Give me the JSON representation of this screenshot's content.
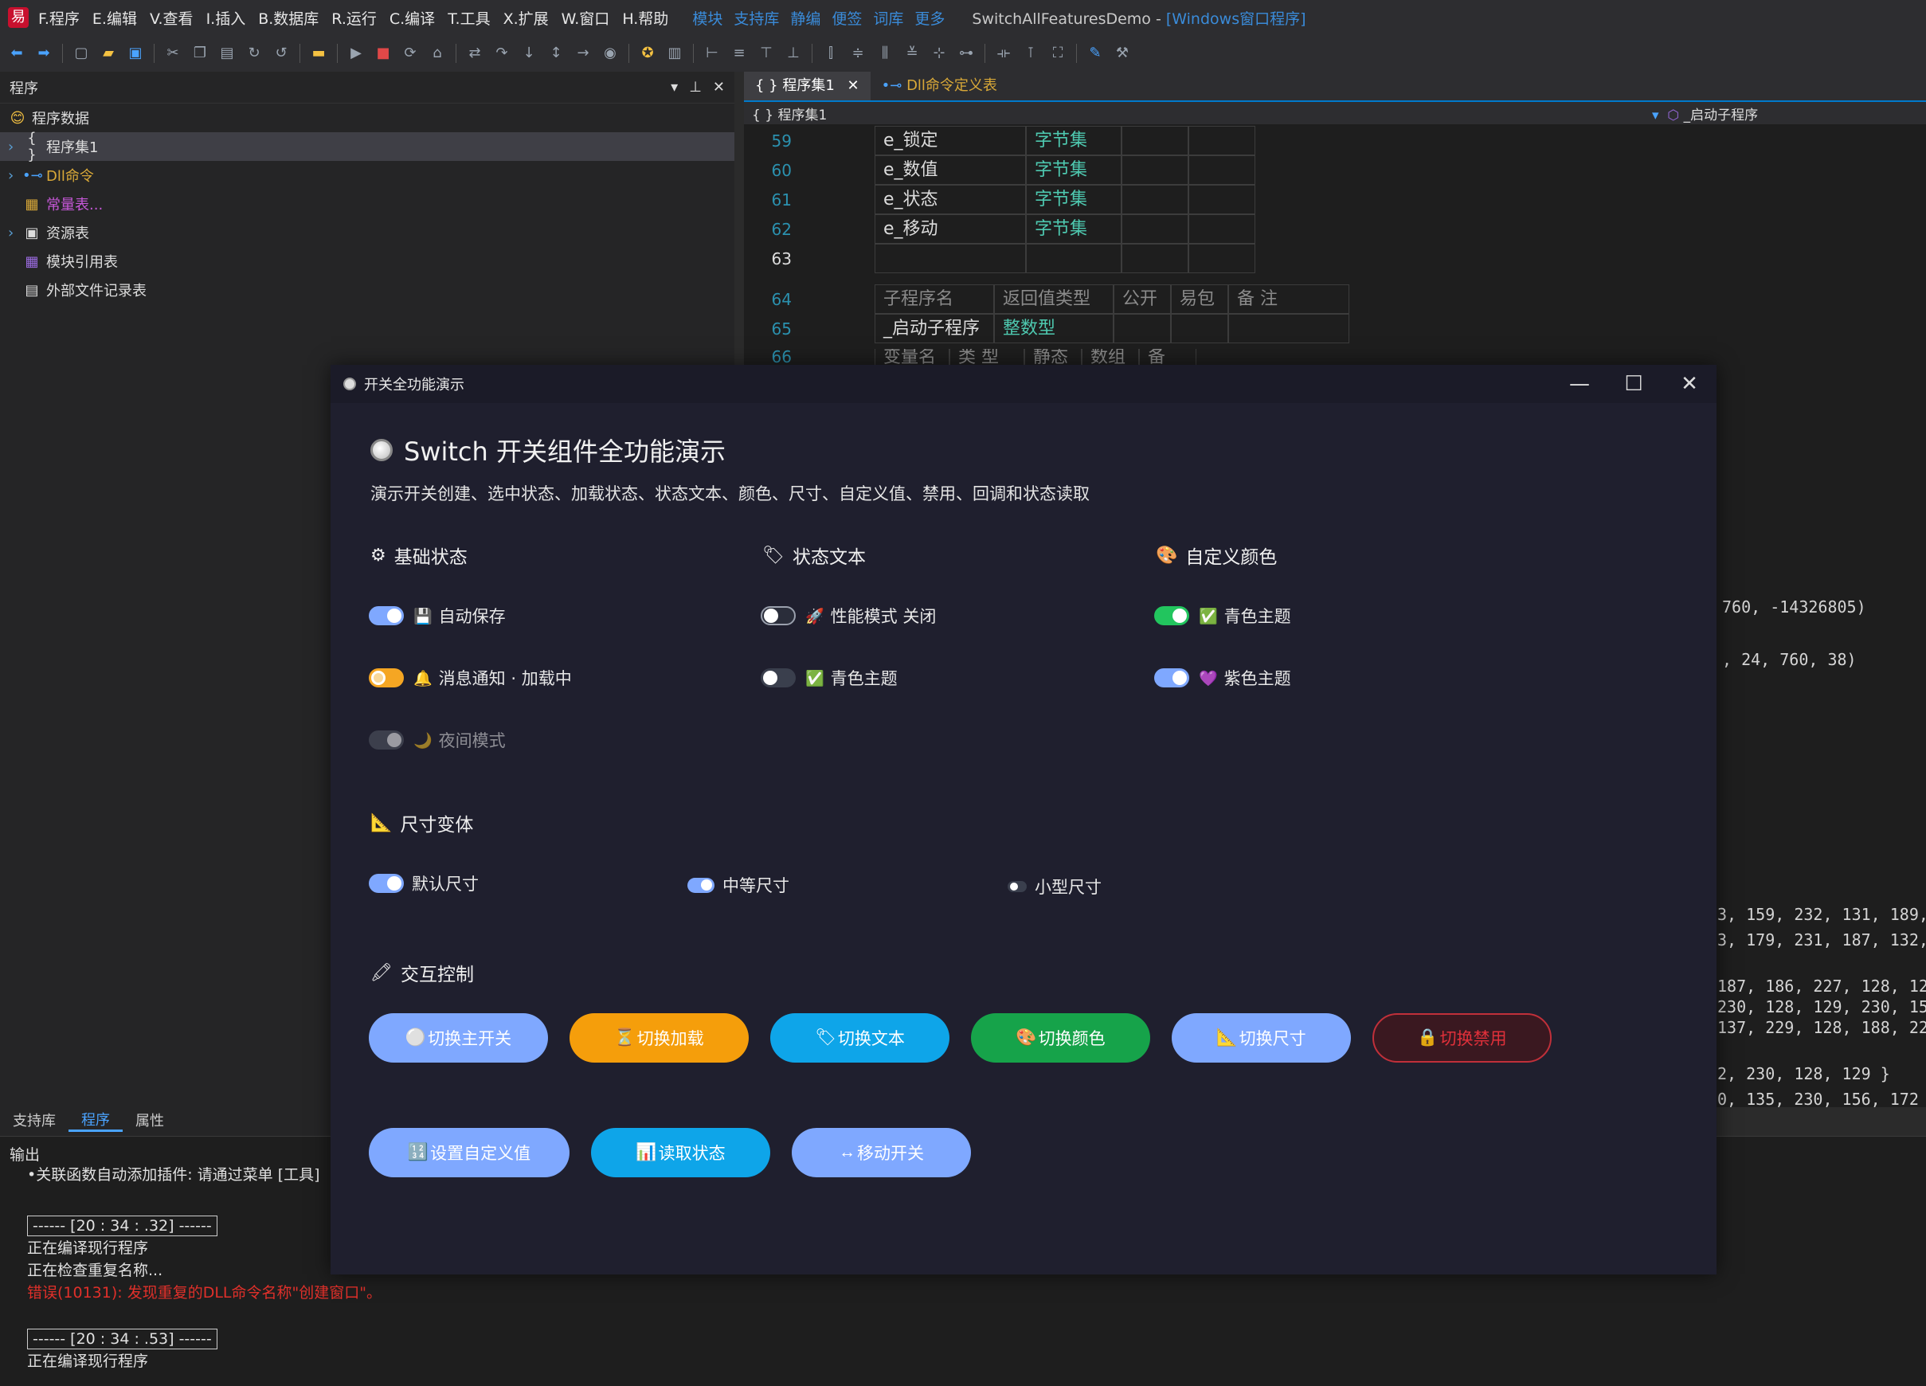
{
  "ide": {
    "menu": [
      "F.程序",
      "E.编辑",
      "V.查看",
      "I.插入",
      "B.数据库",
      "R.运行",
      "C.编译",
      "T.工具",
      "X.扩展",
      "W.窗口",
      "H.帮助"
    ],
    "menu_links": [
      "模块",
      "支持库",
      "静编",
      "便签",
      "词库",
      "更多"
    ],
    "app_title": "SwitchAllFeaturesDemo - ",
    "app_title_suffix": "[Windows窗口程序]",
    "left_panel_title": "程序",
    "tree": [
      {
        "label": "程序数据",
        "icon": "😊"
      },
      {
        "label": "程序集1",
        "icon": "{ }"
      },
      {
        "label": "Dll命令",
        "icon": "•⊸"
      },
      {
        "label": "常量表...",
        "icon": "▦"
      },
      {
        "label": "资源表",
        "icon": "▣"
      },
      {
        "label": "模块引用表",
        "icon": "▦"
      },
      {
        "label": "外部文件记录表",
        "icon": "▤"
      }
    ],
    "panel_tabs": [
      "支持库",
      "程序",
      "属性"
    ],
    "editor_tabs": [
      "程序集1",
      "Dll命令定义表"
    ],
    "editor_breadcrumb": "程序集1",
    "editor_right_crumb": "_启动子程序",
    "code_rows": [
      {
        "ln": "59",
        "name": "e_锁定",
        "type": "字节集"
      },
      {
        "ln": "60",
        "name": "e_数值",
        "type": "字节集"
      },
      {
        "ln": "61",
        "name": "e_状态",
        "type": "字节集"
      },
      {
        "ln": "62",
        "name": "e_移动",
        "type": "字节集"
      },
      {
        "ln": "63",
        "name": "",
        "type": ""
      }
    ],
    "sub_header": {
      "ln": "64",
      "cols": [
        "子程序名",
        "返回值类型",
        "公开",
        "易包",
        "备 注"
      ]
    },
    "sub_row": {
      "ln": "65",
      "name": "_启动子程序",
      "type": "整数型"
    },
    "var_header": {
      "ln": "66",
      "cols": [
        "变量名",
        "类 型",
        "静态",
        "数组",
        "备 注"
      ]
    },
    "right_code": [
      "760, -14326805)",
      ", 24, 760, 38)",
      "3, 159, 232, 131, 189,",
      "3, 179, 231, 187, 132,",
      "187, 186, 227, 128, 12",
      "230, 128, 129, 230, 15",
      "137, 229, 128, 188, 22",
      "2, 230, 128, 129 }",
      "0, 135, 230, 156, 172"
    ],
    "output_title": "输出",
    "output_first": "•关联函数自动添加插件: 请通过菜单 [工具]",
    "stamp1": "------ [20 : 34 : .32] ------",
    "out_lines1": [
      "正在编译现行程序",
      "正在检查重复名称..."
    ],
    "error_line": "错误(10131): 发现重复的DLL命令名称\"创建窗口\"。",
    "stamp2": "------ [20 : 34 : .53] ------",
    "out_lines2": [
      "正在编译现行程序"
    ]
  },
  "demo": {
    "window_title": "开关全功能演示",
    "heading": "Switch 开关组件全功能演示",
    "subtitle": "演示开关创建、选中状态、加载状态、状态文本、颜色、尺寸、自定义值、禁用、回调和状态读取",
    "sections": {
      "basic": {
        "title": "基础状态",
        "icon": "⚙"
      },
      "text": {
        "title": "状态文本",
        "icon": "🏷"
      },
      "color": {
        "title": "自定义颜色",
        "icon": "🎨"
      },
      "size": {
        "title": "尺寸变体",
        "icon": "📐"
      },
      "interact": {
        "title": "交互控制",
        "icon": "🖍"
      }
    },
    "switches": {
      "autosave": {
        "label": "自动保存",
        "emoji": "💾",
        "on": true
      },
      "notify": {
        "label": "消息通知 · 加载中",
        "emoji": "🔔",
        "on": false
      },
      "night": {
        "label": "夜间模式",
        "emoji": "🌙",
        "on": true
      },
      "perf": {
        "label": "性能模式 关闭",
        "emoji": "🚀",
        "on": false
      },
      "cyan1": {
        "label": "青色主题",
        "emoji": "✅",
        "on": false
      },
      "cyan2": {
        "label": "青色主题",
        "emoji": "✅",
        "on": true
      },
      "purple": {
        "label": "紫色主题",
        "emoji": "💜",
        "on": true
      },
      "size_default": {
        "label": "默认尺寸",
        "on": true
      },
      "size_medium": {
        "label": "中等尺寸",
        "on": true
      },
      "size_small": {
        "label": "小型尺寸",
        "on": false
      }
    },
    "buttons": [
      {
        "label": "切换主开关",
        "icon": "⚪",
        "color": "#7fa8ff"
      },
      {
        "label": "切换加载",
        "icon": "⏳",
        "color": "#f59e0b"
      },
      {
        "label": "切换文本",
        "icon": "🏷",
        "color": "#0ea5e9"
      },
      {
        "label": "切换颜色",
        "icon": "🎨",
        "color": "#16a34a"
      },
      {
        "label": "切换尺寸",
        "icon": "📐",
        "color": "#7fa8ff"
      },
      {
        "label": "切换禁用",
        "icon": "🔒",
        "color": "#3a1820"
      }
    ],
    "buttons2": [
      {
        "label": "设置自定义值",
        "icon": "🔢",
        "color": "#7fa8ff"
      },
      {
        "label": "读取状态",
        "icon": "📊",
        "color": "#0ea5e9"
      },
      {
        "label": "移动开关",
        "icon": "↔",
        "color": "#7fa8ff"
      }
    ],
    "colors": {
      "blue": "#7fa8ff",
      "orange": "#f5a623",
      "green": "#22c55e",
      "dark_track": "#3a3f4d",
      "danger": "#e0303a"
    }
  }
}
